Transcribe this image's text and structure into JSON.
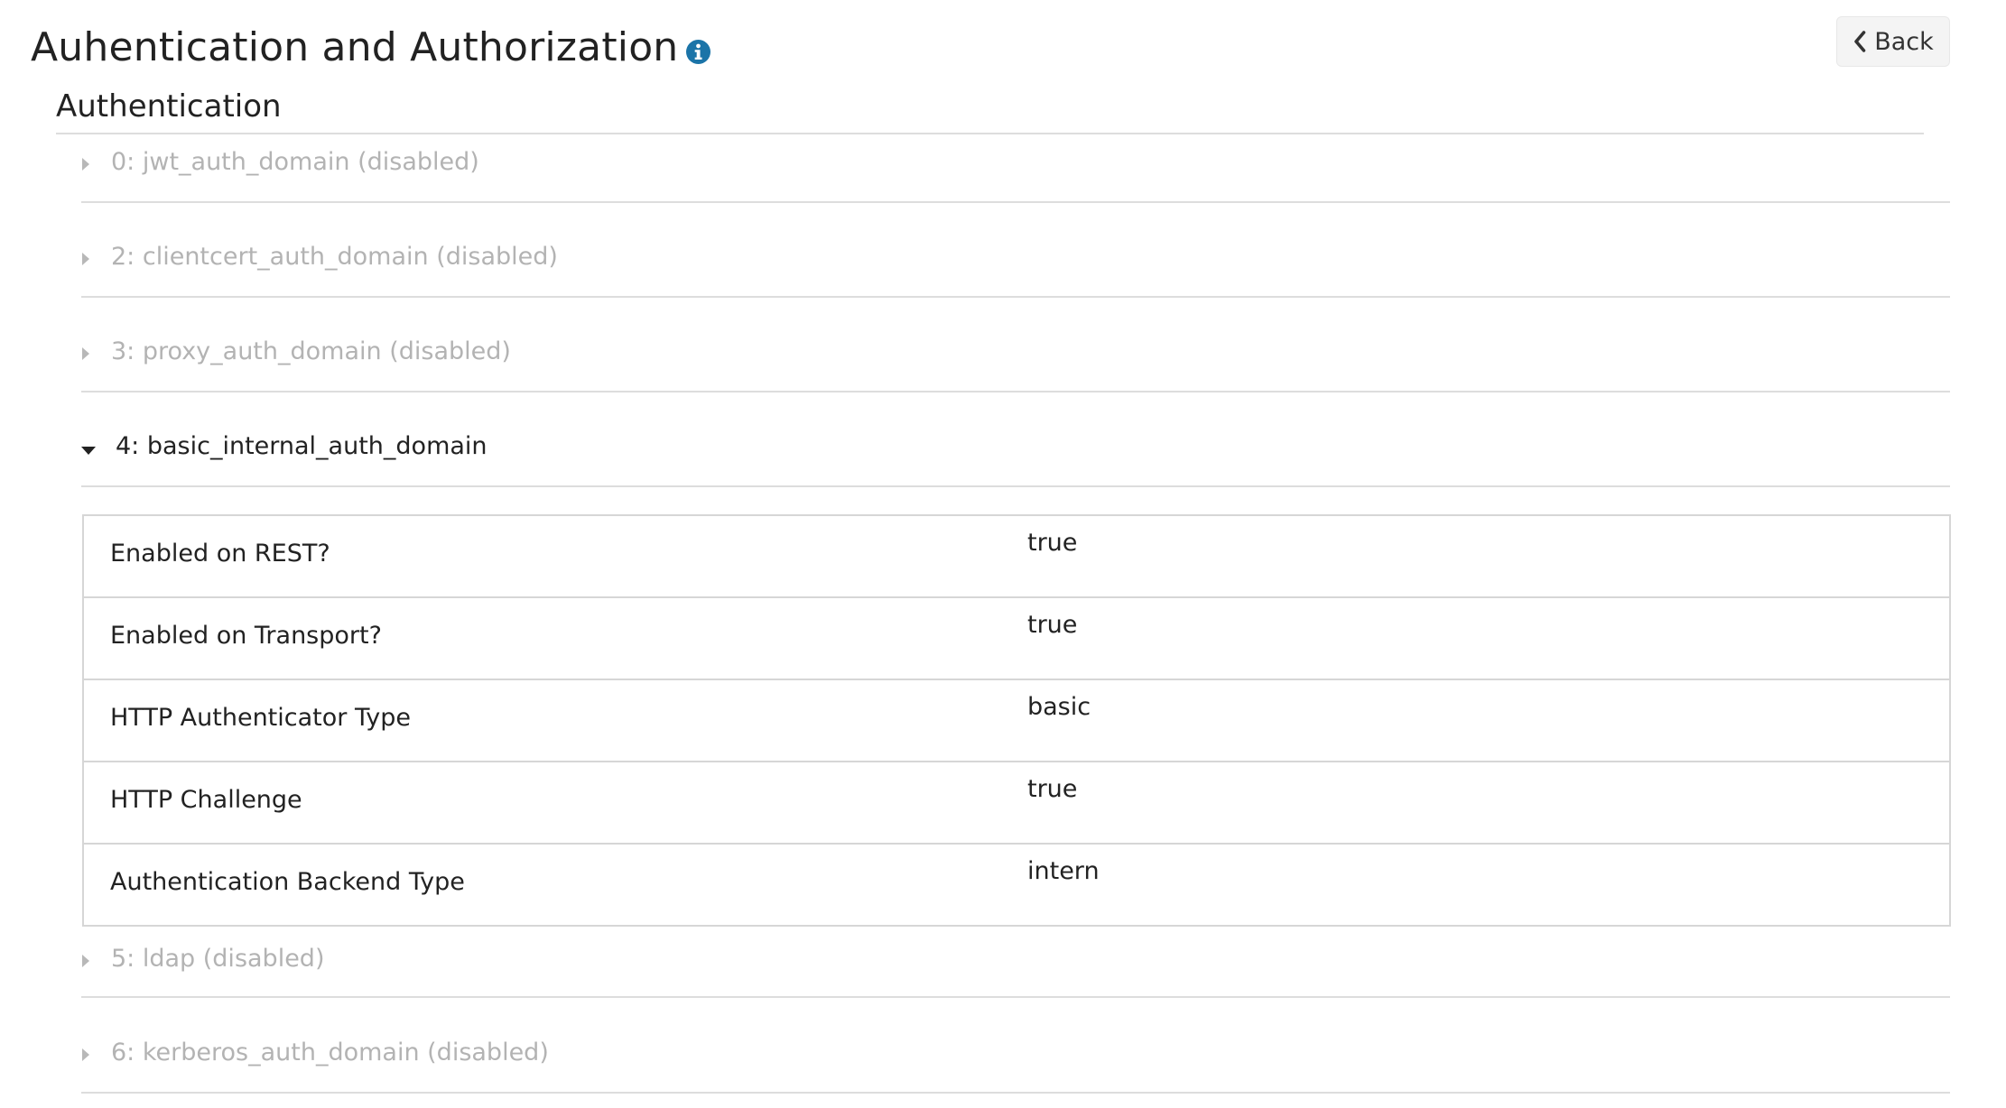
{
  "header": {
    "title": "Auhentication and Authorization",
    "info_icon": "info-circle-icon",
    "back_label": "Back",
    "back_icon": "chevron-left-icon"
  },
  "authentication": {
    "section_title": "Authentication",
    "domains": [
      {
        "label": "0: jwt_auth_domain (disabled)",
        "state": "collapsed",
        "disabled": true
      },
      {
        "label": "2: clientcert_auth_domain (disabled)",
        "state": "collapsed",
        "disabled": true
      },
      {
        "label": "3: proxy_auth_domain (disabled)",
        "state": "collapsed",
        "disabled": true
      },
      {
        "label": "4: basic_internal_auth_domain",
        "state": "expanded",
        "disabled": false
      },
      {
        "label": "5: ldap (disabled)",
        "state": "collapsed",
        "disabled": true
      },
      {
        "label": "6: kerberos_auth_domain (disabled)",
        "state": "collapsed",
        "disabled": true
      }
    ],
    "details": [
      {
        "key": "Enabled on REST?",
        "value": "true"
      },
      {
        "key": "Enabled on Transport?",
        "value": "true"
      },
      {
        "key": "HTTP Authenticator Type",
        "value": "basic"
      },
      {
        "key": "HTTP Challenge",
        "value": "true"
      },
      {
        "key": "Authentication Backend Type",
        "value": "intern"
      }
    ]
  },
  "colors": {
    "info_icon": "#1b74a8",
    "disabled_text": "#b3b3b3",
    "divider": "#dddddd",
    "back_bg": "#f4f4f4"
  }
}
